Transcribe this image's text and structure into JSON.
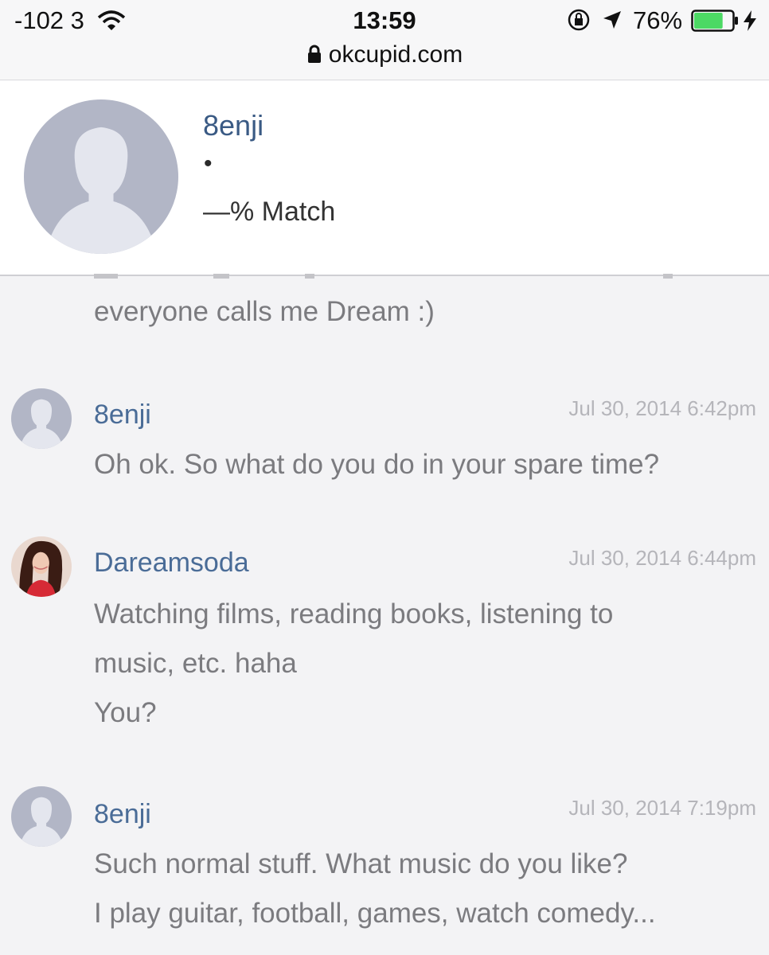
{
  "status_bar": {
    "signal": "-102 3",
    "time": "13:59",
    "battery_percent": "76%",
    "battery_level": 0.76,
    "icons": [
      "wifi-icon",
      "orientation-lock-icon",
      "location-arrow-icon",
      "battery-icon",
      "charging-bolt-icon"
    ]
  },
  "browser": {
    "url": "okcupid.com",
    "lock_icon": "lock-icon"
  },
  "profile": {
    "name": "8enji",
    "dot": "•",
    "match": "—% Match",
    "avatar_icon": "default-avatar-icon"
  },
  "messages": {
    "partial": {
      "text": "everyone calls me Dream :)"
    },
    "items": [
      {
        "author": "8enji",
        "timestamp": "Jul 30, 2014 6:42pm",
        "avatar": "default-avatar-icon",
        "lines": [
          "Oh ok. So what do you do in your spare time?"
        ]
      },
      {
        "author": "Dareamsoda",
        "timestamp": "Jul 30, 2014 6:44pm",
        "avatar": "user-photo-avatar",
        "lines": [
          "Watching films, reading books, listening to",
          "music, etc. haha",
          "You?"
        ]
      },
      {
        "author": "8enji",
        "timestamp": "Jul 30, 2014 7:19pm",
        "avatar": "default-avatar-icon",
        "lines": [
          "Such normal stuff. What music do you like?",
          "I play guitar, football, games, watch comedy..."
        ]
      }
    ]
  },
  "colors": {
    "author_link": "#4a6c97",
    "message_text": "#7b7b7f",
    "timestamp": "#b5b5ba",
    "avatar_placeholder": "#b2b6c6",
    "battery_green": "#4cd964"
  }
}
